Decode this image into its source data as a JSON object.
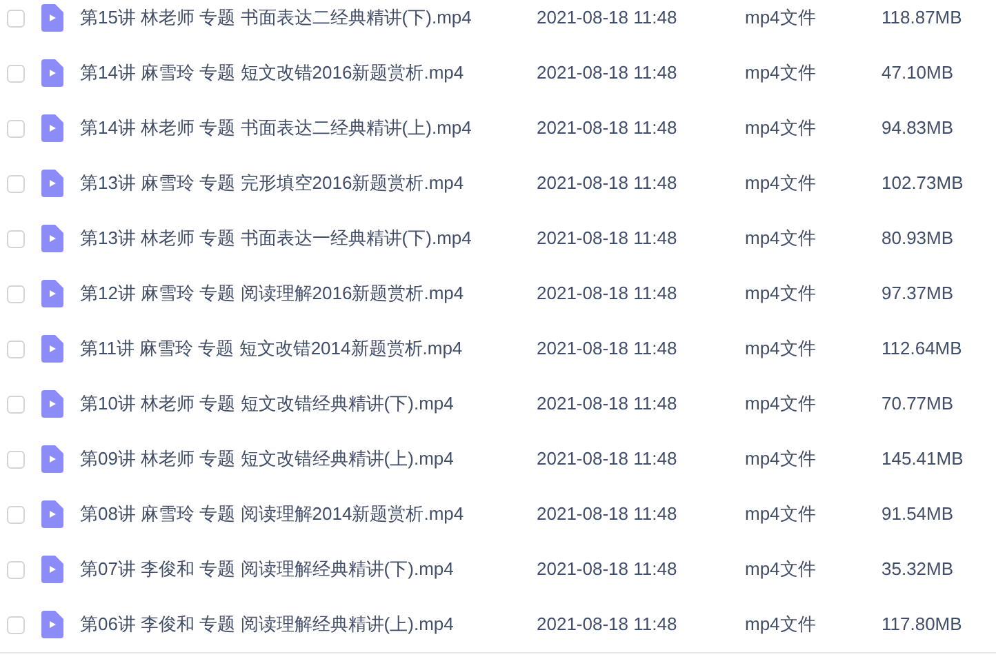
{
  "files": [
    {
      "name": "第15讲 林老师 专题 书面表达二经典精讲(下).mp4",
      "date": "2021-08-18 11:48",
      "type": "mp4文件",
      "size": "118.87MB",
      "checked": false
    },
    {
      "name": "第14讲 麻雪玲 专题 短文改错2016新题赏析.mp4",
      "date": "2021-08-18 11:48",
      "type": "mp4文件",
      "size": "47.10MB",
      "checked": false
    },
    {
      "name": "第14讲 林老师 专题 书面表达二经典精讲(上).mp4",
      "date": "2021-08-18 11:48",
      "type": "mp4文件",
      "size": "94.83MB",
      "checked": false
    },
    {
      "name": "第13讲 麻雪玲 专题 完形填空2016新题赏析.mp4",
      "date": "2021-08-18 11:48",
      "type": "mp4文件",
      "size": "102.73MB",
      "checked": false
    },
    {
      "name": "第13讲 林老师 专题 书面表达一经典精讲(下).mp4",
      "date": "2021-08-18 11:48",
      "type": "mp4文件",
      "size": "80.93MB",
      "checked": false
    },
    {
      "name": "第12讲 麻雪玲 专题 阅读理解2016新题赏析.mp4",
      "date": "2021-08-18 11:48",
      "type": "mp4文件",
      "size": "97.37MB",
      "checked": false
    },
    {
      "name": "第11讲 麻雪玲 专题 短文改错2014新题赏析.mp4",
      "date": "2021-08-18 11:48",
      "type": "mp4文件",
      "size": "112.64MB",
      "checked": false
    },
    {
      "name": "第10讲 林老师 专题 短文改错经典精讲(下).mp4",
      "date": "2021-08-18 11:48",
      "type": "mp4文件",
      "size": "70.77MB",
      "checked": false
    },
    {
      "name": "第09讲 林老师 专题 短文改错经典精讲(上).mp4",
      "date": "2021-08-18 11:48",
      "type": "mp4文件",
      "size": "145.41MB",
      "checked": false
    },
    {
      "name": "第08讲 麻雪玲 专题 阅读理解2014新题赏析.mp4",
      "date": "2021-08-18 11:48",
      "type": "mp4文件",
      "size": "91.54MB",
      "checked": false
    },
    {
      "name": "第07讲 李俊和 专题 阅读理解经典精讲(下).mp4",
      "date": "2021-08-18 11:48",
      "type": "mp4文件",
      "size": "35.32MB",
      "checked": false
    },
    {
      "name": "第06讲 李俊和 专题 阅读理解经典精讲(上).mp4",
      "date": "2021-08-18 11:48",
      "type": "mp4文件",
      "size": "117.80MB",
      "checked": false
    }
  ]
}
